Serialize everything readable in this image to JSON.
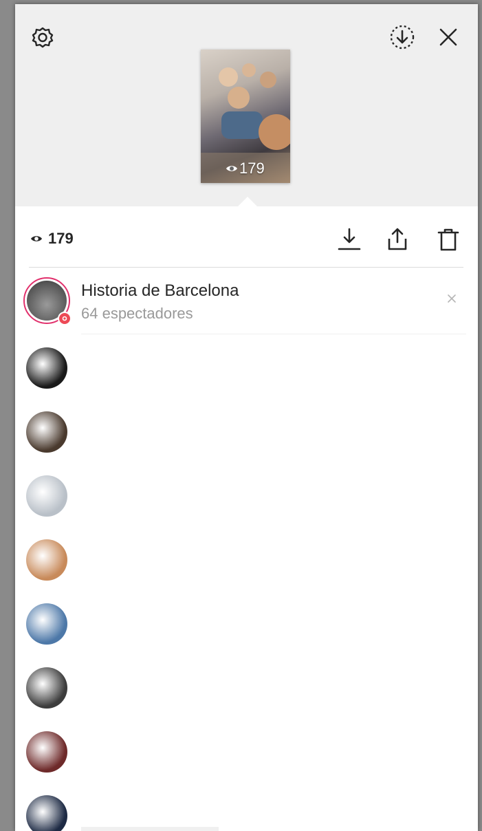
{
  "story": {
    "thumbnail_view_count": "179",
    "view_count": "179"
  },
  "highlight": {
    "title": "Historia de Barcelona",
    "subtitle": "64 espectadores"
  },
  "icons": {
    "settings": "gear-icon",
    "save": "download-circle-icon",
    "close": "close-icon",
    "eye": "eye-icon",
    "download": "download-icon",
    "share": "share-icon",
    "delete": "trash-icon"
  },
  "viewers": [
    {
      "avatar_color": "#1a1a1a"
    },
    {
      "avatar_color": "#4a3a2e"
    },
    {
      "avatar_color": "#b9c0c8"
    },
    {
      "avatar_color": "#c88a5a"
    },
    {
      "avatar_color": "#4d78a8"
    },
    {
      "avatar_color": "#3d3d3d"
    },
    {
      "avatar_color": "#6e2a2a"
    },
    {
      "avatar_color": "#1d2a44"
    }
  ],
  "colors": {
    "highlight_ring": "#e1306c",
    "badge": "#ed4956",
    "text_primary": "#262626",
    "text_secondary": "#999999"
  }
}
